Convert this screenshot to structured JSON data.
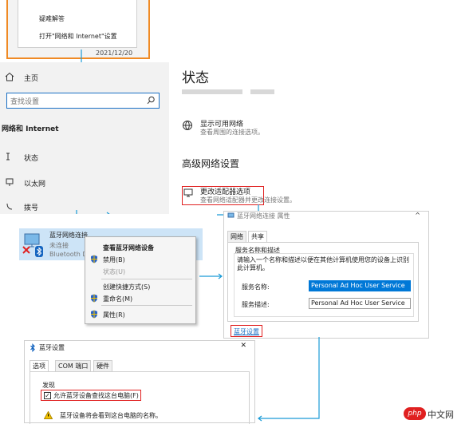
{
  "tray_menu": {
    "items": [
      "疑难解答",
      "打开\"网络和 Internet\"设置"
    ],
    "date": "2021/12/20"
  },
  "settings": {
    "home": "主页",
    "search_placeholder": "查找设置",
    "category": "网络和 Internet",
    "nav": [
      "状态",
      "以太网",
      "拨号"
    ],
    "page_title": "状态",
    "show_networks": {
      "title": "显示可用网络",
      "desc": "查看周围的连接选项。"
    },
    "advanced_title": "高级网络设置",
    "change_adapter": {
      "title": "更改适配器选项",
      "desc": "查看网络适配器并更改连接设置。"
    }
  },
  "adapter": {
    "name": "蓝牙网络连接",
    "status": "未连接",
    "device": "Bluetooth D"
  },
  "context_menu": {
    "items": [
      "查看蓝牙网络设备",
      "禁用(B)",
      "状态(U)",
      "创建快捷方式(S)",
      "重命名(M)",
      "属性(R)"
    ]
  },
  "props_dialog": {
    "title": "蓝牙网络连接 属性",
    "tabs": [
      "网络",
      "共享"
    ],
    "group_label": "服务名称和描述",
    "instructions": "请输入一个名称和描述以便在其他计算机使用您的设备上识别此计算机。",
    "service_name_label": "服务名称:",
    "service_name_value": "Personal Ad Hoc User Service",
    "desc_label": "服务描述:",
    "desc_value": "Personal Ad Hoc User Service",
    "bt_settings_link": "蓝牙设置"
  },
  "bt_dialog": {
    "title": "蓝牙设置",
    "tabs": [
      "选项",
      "COM 端口",
      "硬件"
    ],
    "section": "发现",
    "checkbox_label": "允许蓝牙设备查找这台电脑(F)",
    "warning": "蓝牙设备将会看到这台电脑的名称。"
  },
  "watermark": "php中文网",
  "colors": {
    "accent": "#1a6fc4",
    "highlight_red": "#e02020",
    "tray_orange": "#f08a24"
  }
}
